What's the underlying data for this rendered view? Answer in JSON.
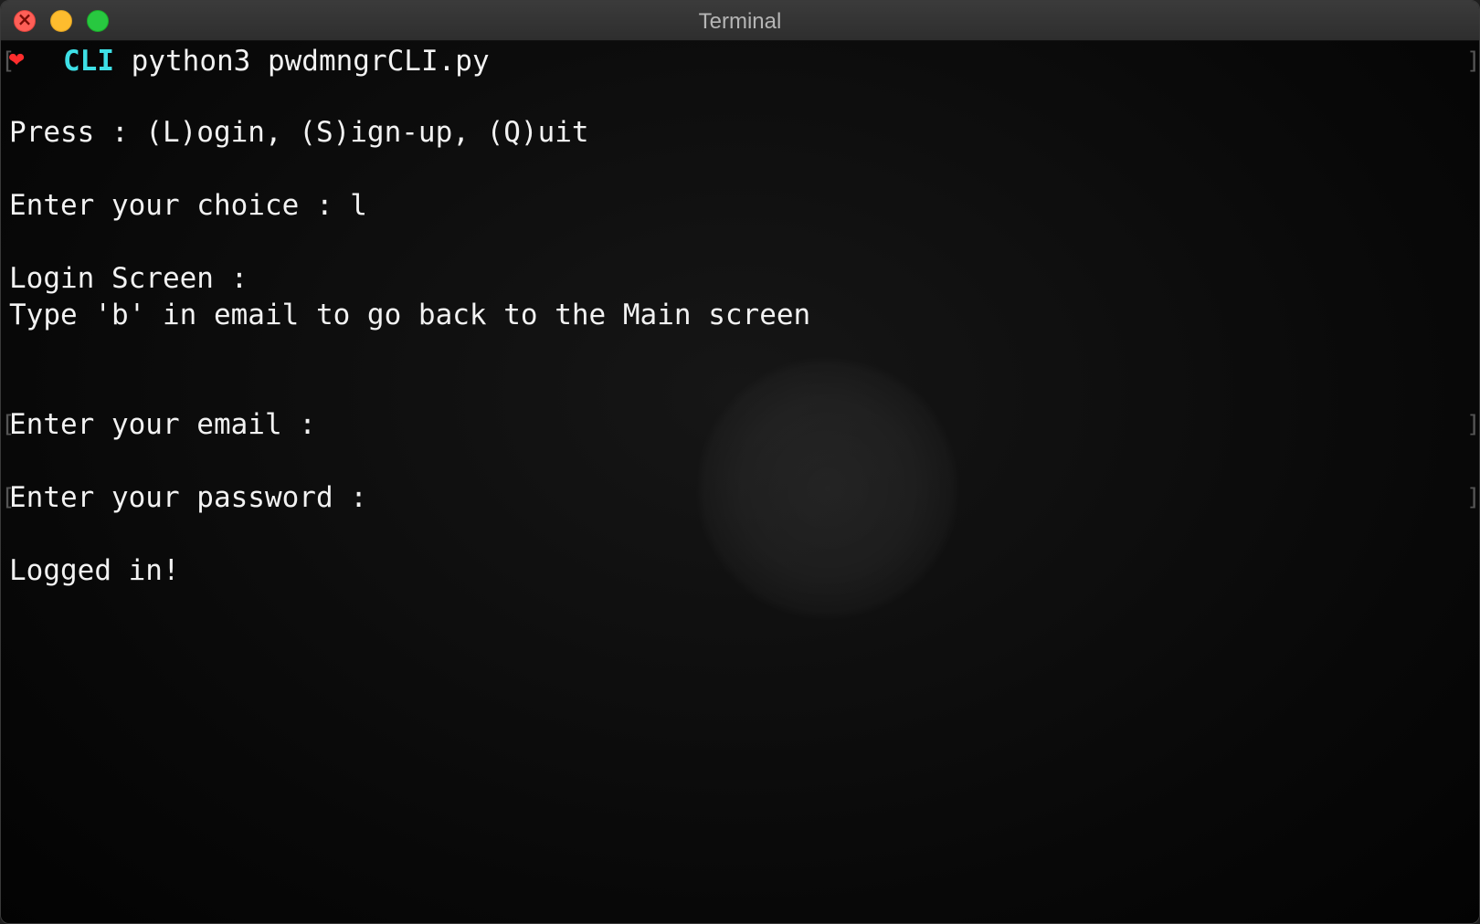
{
  "window": {
    "title": "Terminal",
    "buttons": {
      "close": "close-window",
      "minimize": "minimize-window",
      "zoom": "zoom-window"
    }
  },
  "prompt": {
    "icon": "heart-icon",
    "directory": "CLI",
    "command": "python3 pwdmngrCLI.py"
  },
  "lines": {
    "menu": "Press : (L)ogin, (S)ign-up, (Q)uit",
    "choice": "Enter your choice : l",
    "login_title": "Login Screen :",
    "login_hint": "Type 'b' in email to go back to the Main screen",
    "email_prompt": "Enter your email :",
    "password_prompt": "Enter your password :",
    "result": "Logged in!"
  },
  "colors": {
    "prompt_dir": "#3ee0e6",
    "heart": "#ff2d2d",
    "text": "#f2f2f2",
    "background": "#050505"
  }
}
